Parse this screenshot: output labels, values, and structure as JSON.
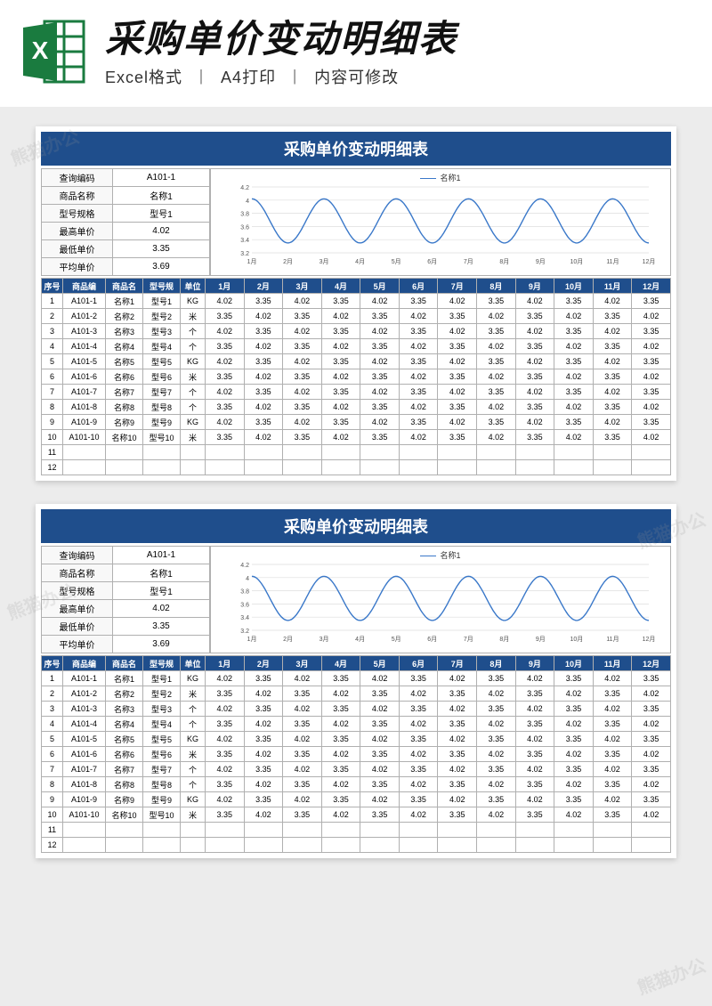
{
  "banner": {
    "title": "采购单价变动明细表",
    "sub_parts": [
      "Excel格式",
      "A4打印",
      "内容可修改"
    ]
  },
  "sheet": {
    "title": "采购单价变动明细表",
    "summary": [
      {
        "label": "查询编码",
        "value": "A101-1"
      },
      {
        "label": "商品名称",
        "value": "名称1"
      },
      {
        "label": "型号规格",
        "value": "型号1"
      },
      {
        "label": "最高单价",
        "value": "4.02"
      },
      {
        "label": "最低单价",
        "value": "3.35"
      },
      {
        "label": "平均单价",
        "value": "3.69"
      }
    ],
    "chart_legend": "名称1",
    "headers": [
      "序号",
      "商品编",
      "商品名",
      "型号规",
      "单位",
      "1月",
      "2月",
      "3月",
      "4月",
      "5月",
      "6月",
      "7月",
      "8月",
      "9月",
      "10月",
      "11月",
      "12月"
    ],
    "units": [
      "KG",
      "米",
      "个",
      "个",
      "KG",
      "米",
      "个",
      "个",
      "KG",
      "米"
    ]
  },
  "chart_data": {
    "type": "line",
    "title": "",
    "xlabel": "",
    "ylabel": "",
    "categories": [
      "1月",
      "2月",
      "3月",
      "4月",
      "5月",
      "6月",
      "7月",
      "8月",
      "9月",
      "10月",
      "11月",
      "12月"
    ],
    "series": [
      {
        "name": "名称1",
        "values": [
          4.02,
          3.35,
          4.02,
          3.35,
          4.02,
          3.35,
          4.02,
          3.35,
          4.02,
          3.35,
          4.02,
          3.35
        ]
      }
    ],
    "ylim": [
      3.2,
      4.2
    ],
    "yticks": [
      3.2,
      3.4,
      3.6,
      3.8,
      4,
      4.2
    ],
    "grid": true,
    "legend_position": "top"
  },
  "watermarks": [
    "熊猫办公",
    "熊猫办公",
    "熊猫办公",
    "熊猫办公"
  ]
}
